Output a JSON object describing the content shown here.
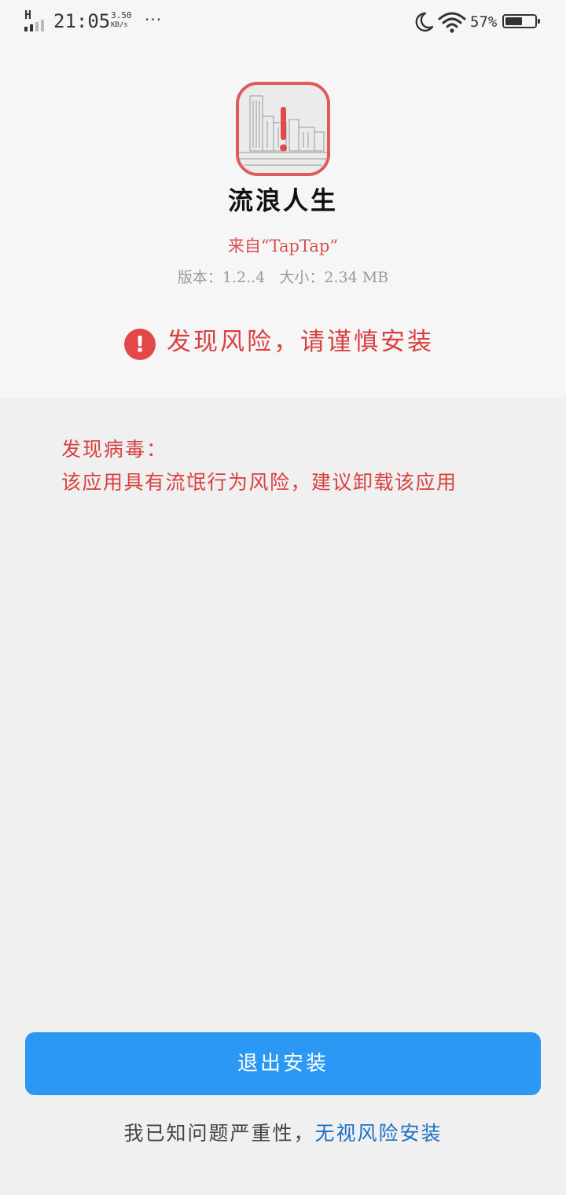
{
  "status_bar": {
    "network": "H",
    "time": "21:05",
    "speed_value": "3.50",
    "speed_unit": "KB/s",
    "overflow": "···",
    "battery_percent": "57%",
    "battery_level": 0.57,
    "icons": [
      "moon-icon",
      "wifi-icon",
      "battery-icon"
    ]
  },
  "app": {
    "name": "流浪人生",
    "source": "来自“TapTap”",
    "meta": "版本：1.2..4   大小：2.34 MB",
    "icon": "warning-app-icon"
  },
  "risk": {
    "icon": "exclamation-icon",
    "title": "发现风险，请谨慎安装",
    "virus_title": "发现病毒：",
    "virus_desc": "该应用具有流氓行为风险，建议卸载该应用"
  },
  "actions": {
    "exit_label": "退出安装",
    "ignore_prefix": "我已知问题严重性，",
    "ignore_link": "无视风险安装"
  },
  "colors": {
    "danger": "#d94040",
    "primary": "#2b98f3",
    "link": "#1a6fc9"
  }
}
